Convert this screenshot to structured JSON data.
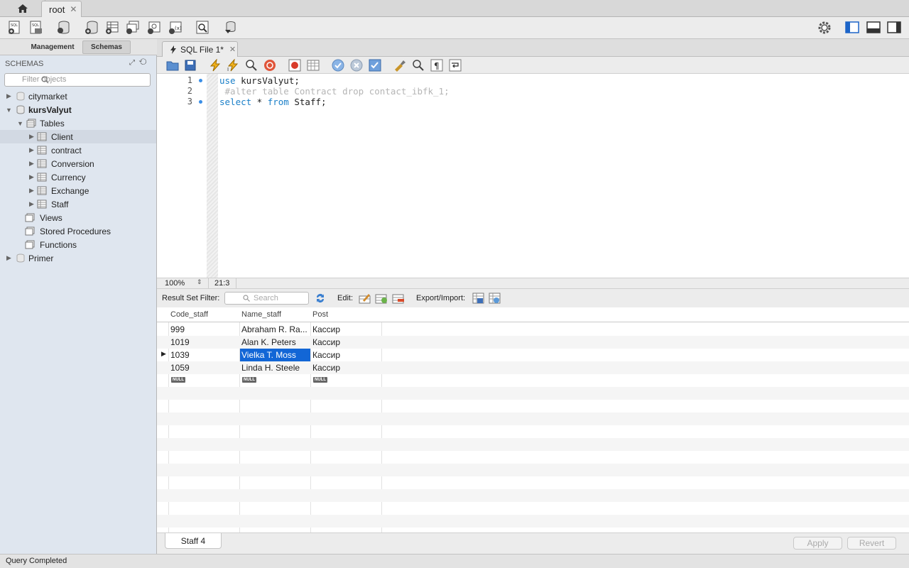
{
  "tabs": {
    "home_icon": "home-icon",
    "connection": "root",
    "close": "✕"
  },
  "sidebar": {
    "tabs": [
      "Management",
      "Schemas"
    ],
    "title": "SCHEMAS",
    "filter_placeholder": "Filter objects",
    "tree": [
      {
        "label": "citymarket",
        "bold": false
      },
      {
        "label": "kursValyut",
        "bold": true
      },
      {
        "label": "Tables"
      },
      {
        "label": "Client"
      },
      {
        "label": "contract"
      },
      {
        "label": "Conversion"
      },
      {
        "label": "Currency"
      },
      {
        "label": "Exchange"
      },
      {
        "label": "Staff"
      },
      {
        "label": "Views"
      },
      {
        "label": "Stored Procedures"
      },
      {
        "label": "Functions"
      },
      {
        "label": "Primer"
      }
    ]
  },
  "editor": {
    "tab_label": "SQL File 1*",
    "lines": [
      {
        "num": "1",
        "kw": "use",
        "rest": " kursValyut;"
      },
      {
        "num": "2",
        "comment": " #alter table Contract drop contact_ibfk_1;"
      },
      {
        "num": "3",
        "kw": "select",
        "mid": " * ",
        "kw2": "from",
        "rest": " Staff;"
      }
    ],
    "zoom": "100%",
    "cursor": "21:3"
  },
  "results": {
    "filter_label": "Result Set Filter:",
    "search_placeholder": "Search",
    "edit_label": "Edit:",
    "export_label": "Export/Import:",
    "columns": [
      "Code_staff",
      "Name_staff",
      "Post"
    ],
    "rows": [
      [
        "999",
        "Abraham R. Ra...",
        "Кассир"
      ],
      [
        "1019",
        "Alan K. Peters",
        "Кассир"
      ],
      [
        "1039",
        "Vielka T. Moss",
        "Кассир"
      ],
      [
        "1059",
        "Linda H. Steele",
        "Кассир"
      ]
    ],
    "null_label": "NULL",
    "result_tab": "Staff 4",
    "apply": "Apply",
    "revert": "Revert"
  },
  "status": "Query Completed"
}
